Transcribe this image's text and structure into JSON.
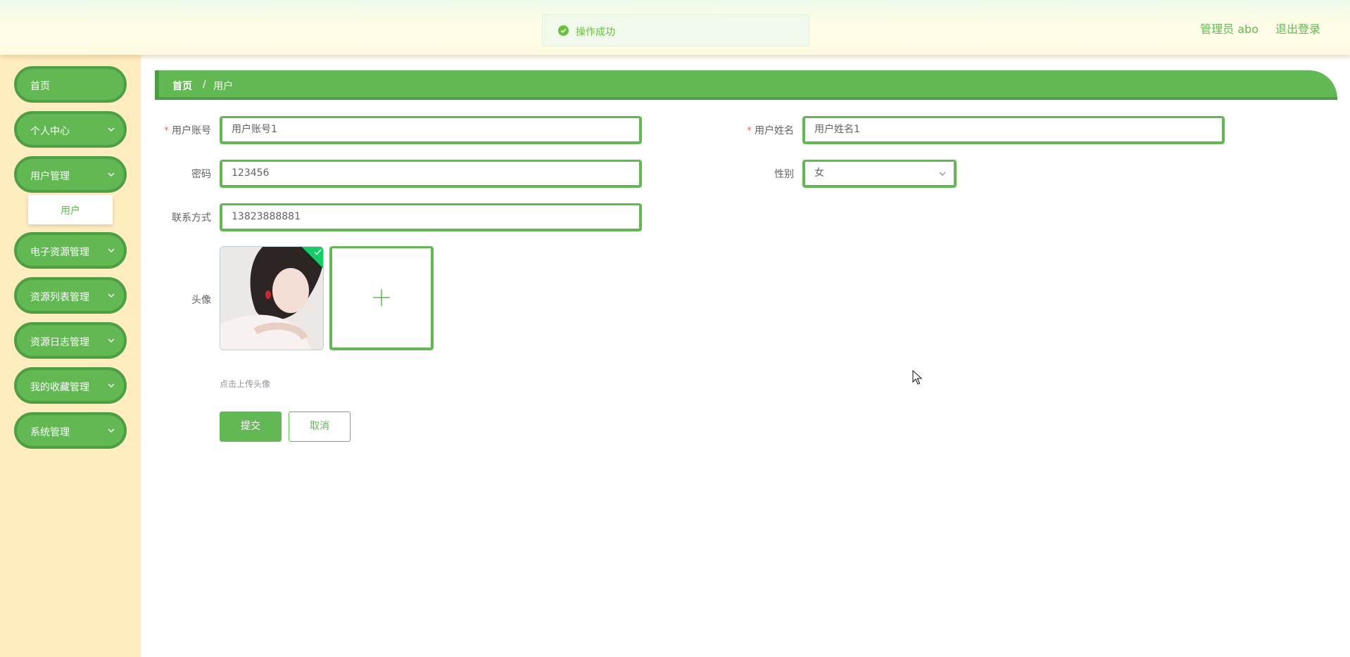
{
  "header": {
    "user_label": "管理员 abo",
    "logout_label": "退出登录"
  },
  "toast": {
    "message": "操作成功"
  },
  "sidebar": {
    "items": [
      {
        "label": "首页"
      },
      {
        "label": "个人中心"
      },
      {
        "label": "用户管理"
      },
      {
        "label": "电子资源管理"
      },
      {
        "label": "资源列表管理"
      },
      {
        "label": "资源日志管理"
      },
      {
        "label": "我的收藏管理"
      },
      {
        "label": "系统管理"
      }
    ],
    "submenu": {
      "label": "用户"
    }
  },
  "breadcrumb": {
    "home": "首页",
    "separator": "/",
    "current": "用户"
  },
  "form": {
    "account": {
      "label": "用户账号",
      "value": "用户账号1"
    },
    "name": {
      "label": "用户姓名",
      "value": "用户姓名1"
    },
    "password": {
      "label": "密码",
      "value": "123456"
    },
    "gender": {
      "label": "性别",
      "value": "女"
    },
    "phone": {
      "label": "联系方式",
      "value": "13823888881"
    },
    "avatar": {
      "label": "头像",
      "hint": "点击上传头像"
    },
    "required_mark": "*",
    "submit_label": "提交",
    "cancel_label": "取消"
  },
  "colors": {
    "accent": "#62b954",
    "accent_dark": "#4e9e43",
    "sidebar_bg": "#ffecbf",
    "required": "#f56c6c"
  }
}
